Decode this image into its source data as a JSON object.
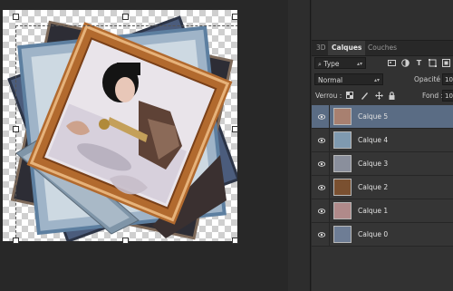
{
  "panel": {
    "tabs": [
      {
        "label": "3D",
        "active": false
      },
      {
        "label": "Calques",
        "active": true
      },
      {
        "label": "Couches",
        "active": false
      }
    ],
    "filter": {
      "label": "Type",
      "icon": "search-icon"
    },
    "filter_icons": [
      "image-filter-icon",
      "adjustment-filter-icon",
      "type-filter-icon",
      "shape-filter-icon",
      "smart-object-filter-icon"
    ],
    "blend_mode": "Normal",
    "opacity_label": "Opacité :",
    "opacity_value": "10",
    "lock_label": "Verrou :",
    "fill_label": "Fond :",
    "fill_value": "10",
    "lock_icons": [
      "lock-transparency-icon",
      "lock-paint-icon",
      "lock-position-icon",
      "lock-all-icon"
    ],
    "layers": [
      {
        "name": "Calque 5",
        "selected": true,
        "thumb_color": "#a88070"
      },
      {
        "name": "Calque 4",
        "selected": false,
        "thumb_color": "#7f9ab0"
      },
      {
        "name": "Calque 3",
        "selected": false,
        "thumb_color": "#8a8f9c"
      },
      {
        "name": "Calque 2",
        "selected": false,
        "thumb_color": "#7a5030"
      },
      {
        "name": "Calque 1",
        "selected": false,
        "thumb_color": "#b08a8a"
      },
      {
        "name": "Calque 0",
        "selected": false,
        "thumb_color": "#6e7d95"
      }
    ]
  },
  "colors": {
    "selected_layer": "#5a6c84",
    "panel_bg": "#323232",
    "canvas_bg": "#282828"
  }
}
